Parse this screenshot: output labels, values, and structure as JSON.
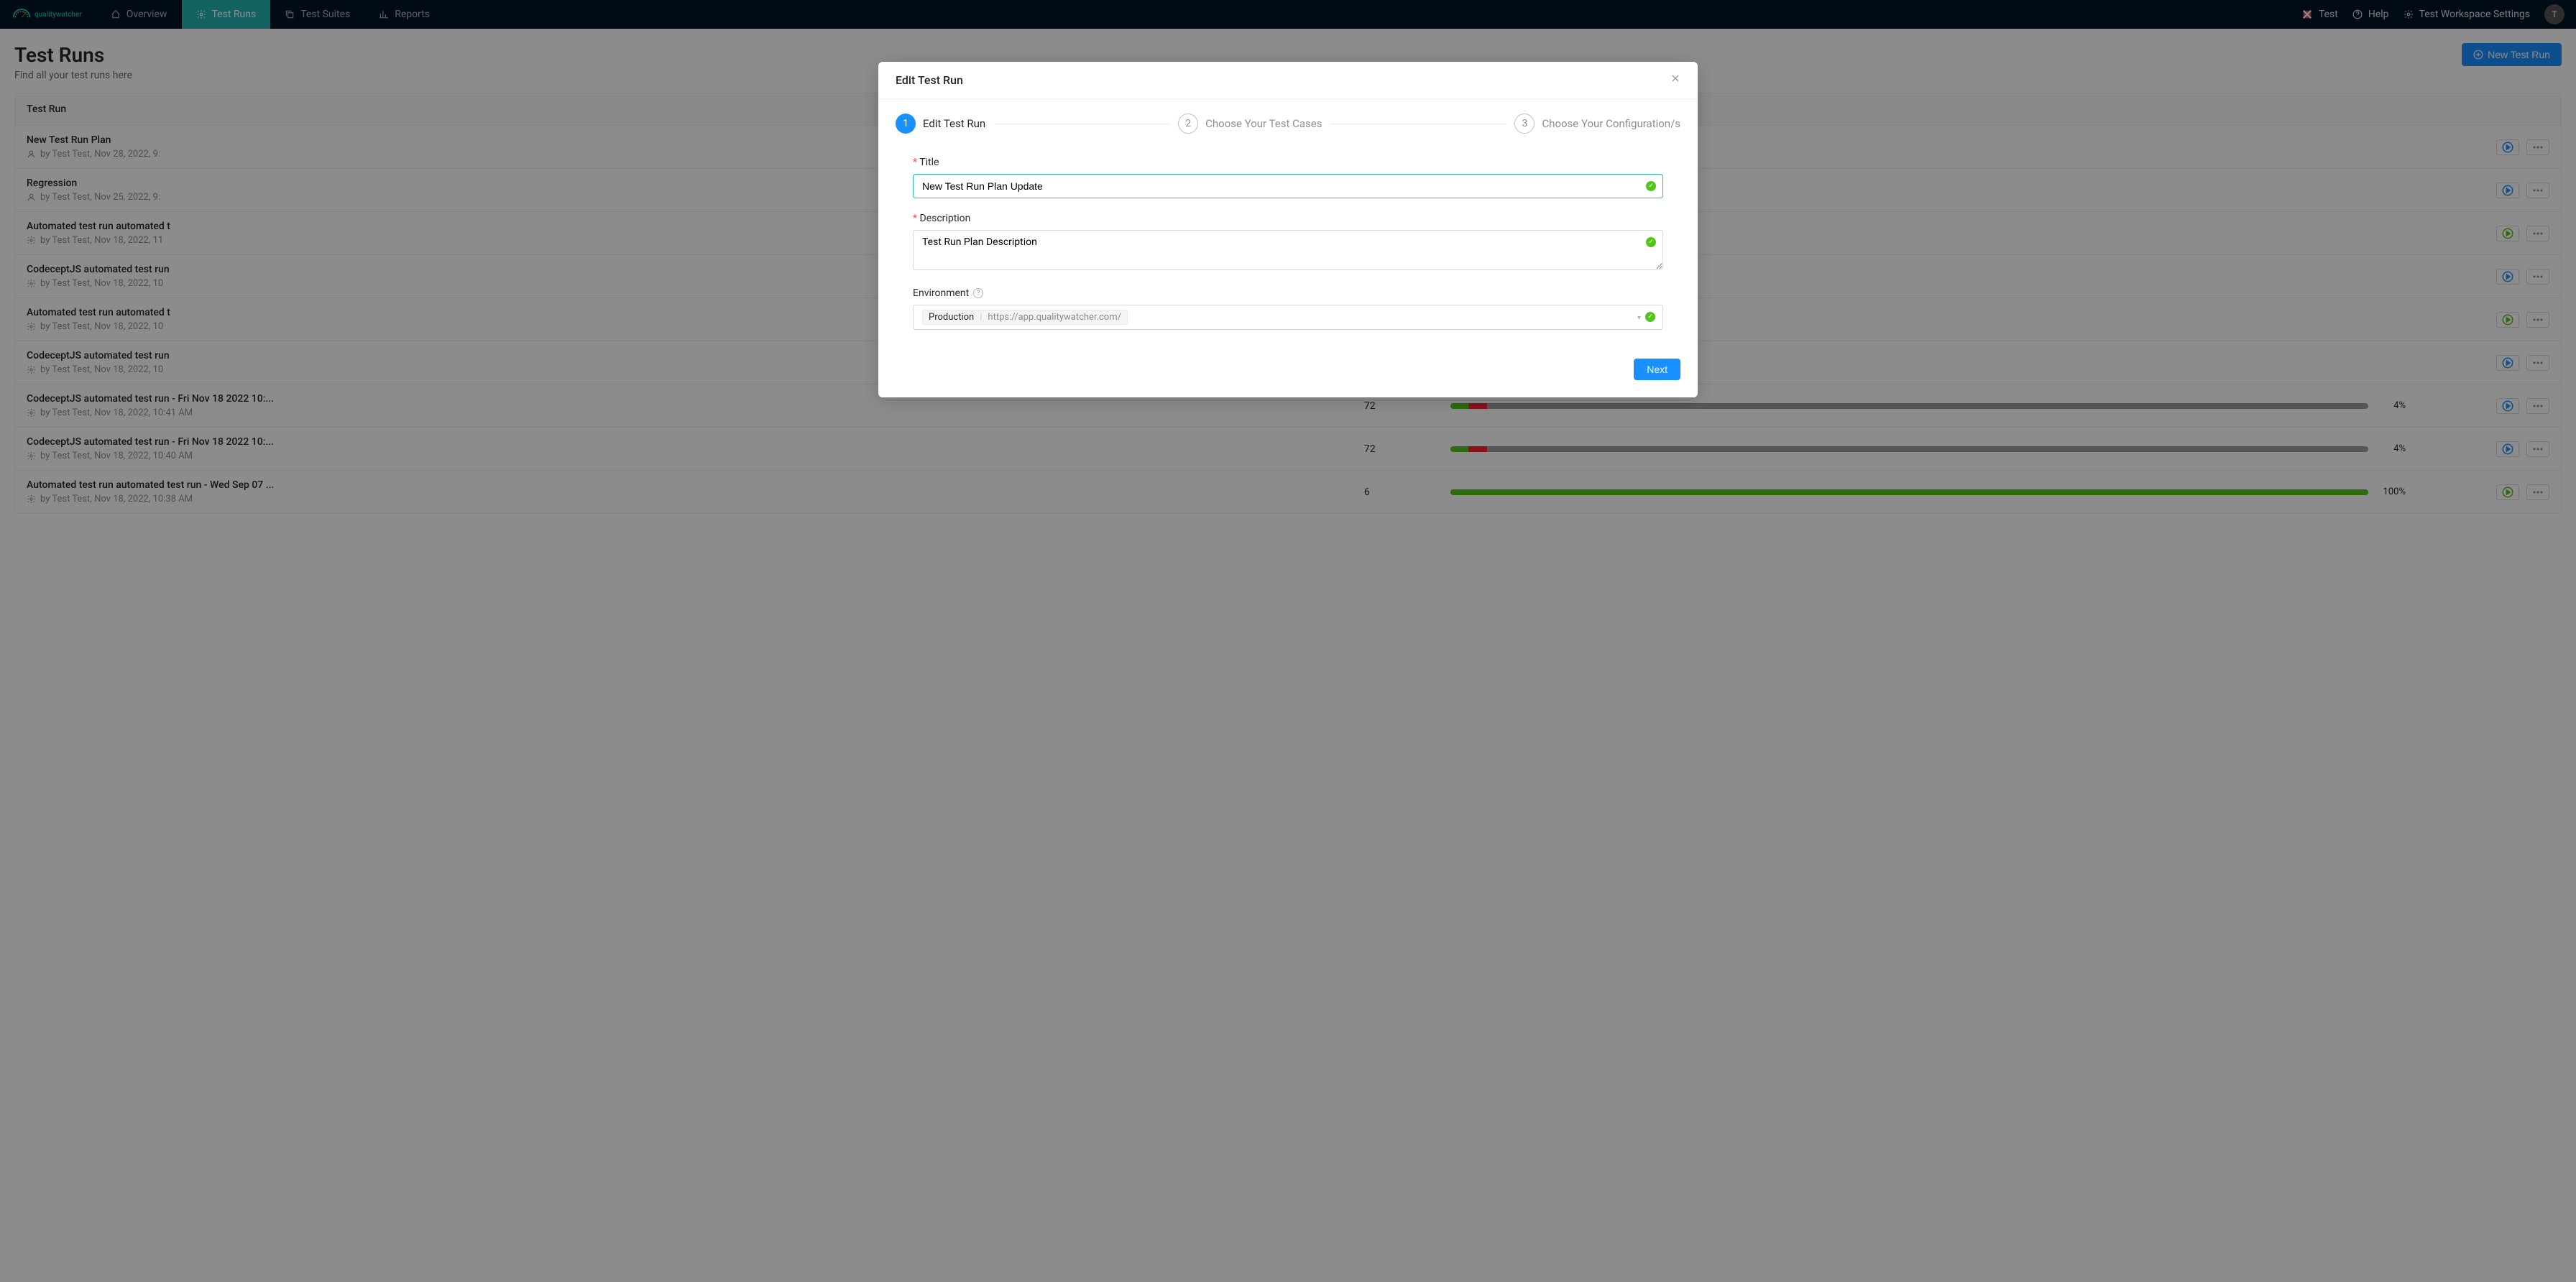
{
  "nav": {
    "brand": "qualitywatcher",
    "items": [
      {
        "label": "Overview"
      },
      {
        "label": "Test Runs"
      },
      {
        "label": "Test Suites"
      },
      {
        "label": "Reports"
      }
    ],
    "right": {
      "test": "Test",
      "help": "Help",
      "settings": "Test Workspace Settings",
      "avatar": "T"
    }
  },
  "header": {
    "title": "Test Runs",
    "subtitle": "Find all your test runs here",
    "new_button": "New Test Run"
  },
  "table": {
    "col_name": "Test Run",
    "rows": [
      {
        "title": "New Test Run Plan",
        "meta": "by Test Test, Nov 28, 2022, 9:",
        "icon": "user",
        "play": "blue"
      },
      {
        "title": "Regression",
        "meta": "by Test Test, Nov 25, 2022, 9:",
        "icon": "user",
        "play": "blue"
      },
      {
        "title": "Automated test run automated t",
        "meta": "by Test Test, Nov 18, 2022, 11",
        "icon": "gear",
        "play": "green"
      },
      {
        "title": "CodeceptJS automated test run",
        "meta": "by Test Test, Nov 18, 2022, 10",
        "icon": "gear",
        "play": "blue"
      },
      {
        "title": "Automated test run automated t",
        "meta": "by Test Test, Nov 18, 2022, 10",
        "icon": "gear",
        "play": "green"
      },
      {
        "title": "CodeceptJS automated test run",
        "meta": "by Test Test, Nov 18, 2022, 10",
        "icon": "gear",
        "play": "blue"
      },
      {
        "title": "CodeceptJS automated test run - Fri Nov 18 2022 10:...",
        "meta": "by Test Test, Nov 18, 2022, 10:41 AM",
        "icon": "gear",
        "count": "72",
        "pct": "4%",
        "green": 2,
        "red": 2,
        "play": "blue"
      },
      {
        "title": "CodeceptJS automated test run - Fri Nov 18 2022 10:...",
        "meta": "by Test Test, Nov 18, 2022, 10:40 AM",
        "icon": "gear",
        "count": "72",
        "pct": "4%",
        "green": 2,
        "red": 2,
        "play": "blue"
      },
      {
        "title": "Automated test run automated test run - Wed Sep 07 ...",
        "meta": "by Test Test, Nov 18, 2022, 10:38 AM",
        "icon": "gear",
        "count": "6",
        "pct": "100%",
        "green": 100,
        "red": 0,
        "play": "green"
      }
    ]
  },
  "modal": {
    "title": "Edit Test Run",
    "steps": {
      "s1": "Edit Test Run",
      "s2": "Choose Your Test Cases",
      "s3": "Choose Your Configuration/s"
    },
    "form": {
      "title_label": "Title",
      "title_value": "New Test Run Plan Update",
      "desc_label": "Description",
      "desc_value": "Test Run Plan Description",
      "env_label": "Environment",
      "env_name": "Production",
      "env_url": "https://app.qualitywatcher.com/"
    },
    "next": "Next"
  }
}
